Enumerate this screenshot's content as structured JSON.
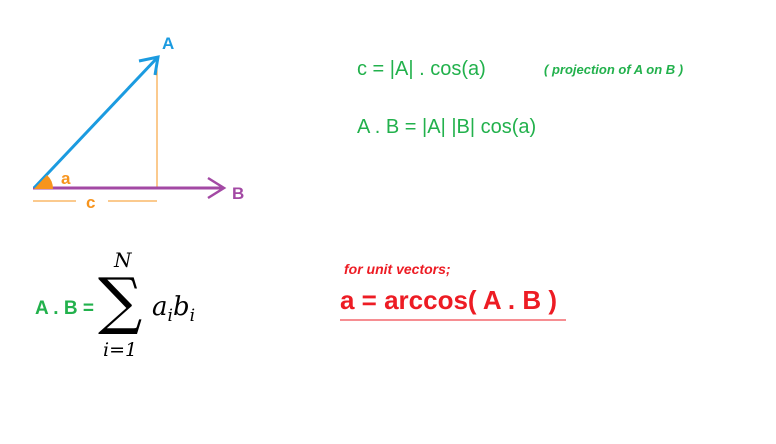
{
  "colors": {
    "vector_a": "#1b9be0",
    "vector_b": "#a349a4",
    "projection": "#f7941d",
    "green_text": "#22b14c",
    "red_text": "#ed1c24"
  },
  "diagram": {
    "label_a": "A",
    "label_b": "B",
    "angle_label": "a",
    "projection_label": "c"
  },
  "formulas": {
    "projection": "c = |A| . cos(a)",
    "projection_note": "( projection of A on B )",
    "dot_product": "A . B = |A| |B| cos(a)",
    "sum_lhs": "A . B =",
    "sum_upper": "N",
    "sum_symbol": "∑",
    "sum_lower": "i=1",
    "term_a": "a",
    "sub_a": "i",
    "term_b": "b",
    "sub_b": "i",
    "unit_note": "for unit vectors;",
    "arccos": "a = arccos( A . B )"
  }
}
